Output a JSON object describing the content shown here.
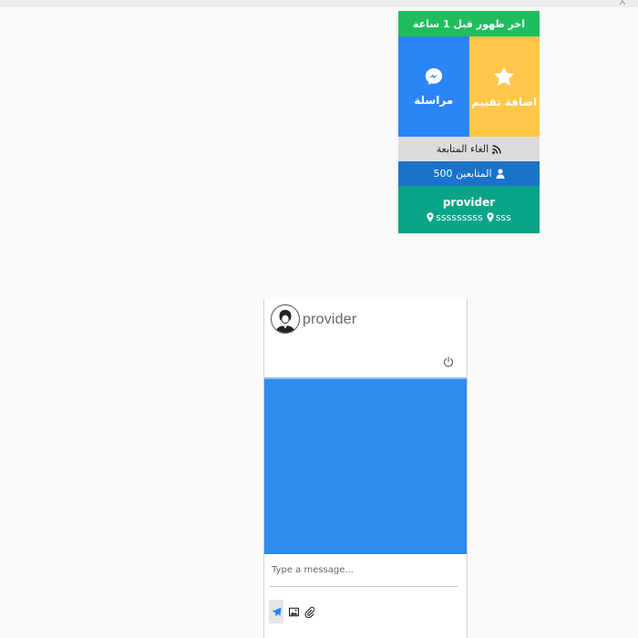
{
  "profile_card": {
    "last_seen": "اخر ظهور قبل 1 ساعة",
    "message_tile": {
      "label": "مراسلة",
      "icon": "messenger-icon"
    },
    "rate_tile": {
      "label": "اضافة تقييم",
      "icon": "star-icon"
    },
    "unfollow": {
      "label": "الغاء المتابعة",
      "icon": "rss-icon"
    },
    "followers": {
      "label": "المتابعين 500",
      "icon": "user-icon"
    },
    "provider_name": "provider",
    "locations": [
      {
        "text": "sss",
        "icon": "map-marker-icon"
      },
      {
        "text": "sssssssss",
        "icon": "map-marker-icon"
      }
    ],
    "colors": {
      "last_seen": "#20bd5f",
      "message": "#2b85f6",
      "rate": "#ffc64a",
      "unfollow": "#dcdcdc",
      "followers": "#1a73c9",
      "info": "#0aa488"
    }
  },
  "chat": {
    "name": "provider",
    "avatar_icon": "avatar-icon",
    "power_icon": "power-icon",
    "input": {
      "value": "",
      "placeholder": "Type a message..."
    },
    "tools": [
      "send-icon",
      "image-icon",
      "paperclip-icon"
    ],
    "body_color": "#2f8ced"
  }
}
